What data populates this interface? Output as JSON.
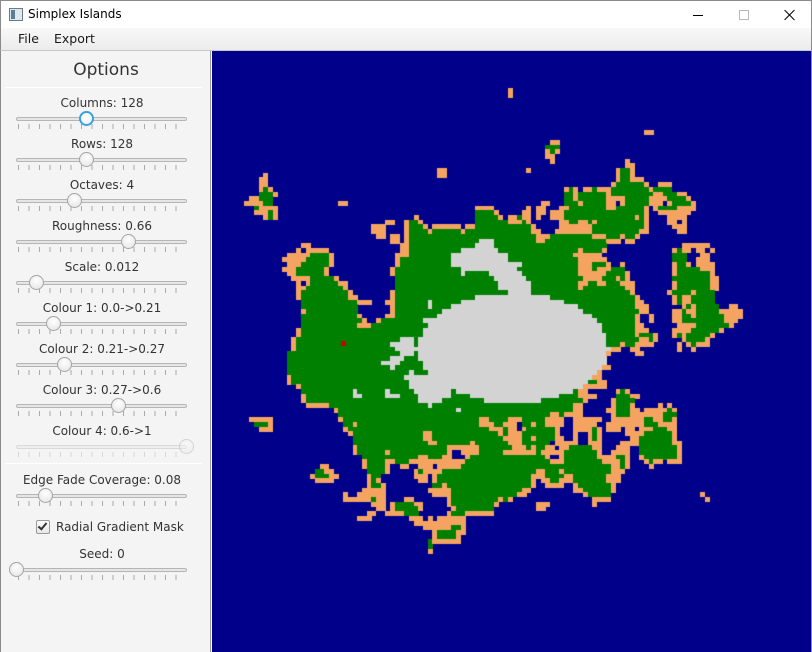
{
  "window": {
    "title": "Simplex Islands",
    "icon": "app-window-icon",
    "controls": [
      "minimize-icon",
      "maximize-icon",
      "close-icon"
    ]
  },
  "menu": {
    "file": "File",
    "export": "Export"
  },
  "options": {
    "title": "Options",
    "sliders": [
      {
        "id": "columns",
        "label": "Columns: 128",
        "fraction": 0.41,
        "focused": true,
        "disabled": false
      },
      {
        "id": "rows",
        "label": "Rows: 128",
        "fraction": 0.41,
        "focused": false,
        "disabled": false
      },
      {
        "id": "octaves",
        "label": "Octaves: 4",
        "fraction": 0.34,
        "focused": false,
        "disabled": false
      },
      {
        "id": "roughness",
        "label": "Roughness: 0.66",
        "fraction": 0.66,
        "focused": false,
        "disabled": false
      },
      {
        "id": "scale",
        "label": "Scale: 0.012",
        "fraction": 0.12,
        "focused": false,
        "disabled": false
      },
      {
        "id": "colour1",
        "label": "Colour 1: 0.0->0.21",
        "fraction": 0.22,
        "focused": false,
        "disabled": false
      },
      {
        "id": "colour2",
        "label": "Colour 2: 0.21->0.27",
        "fraction": 0.28,
        "focused": false,
        "disabled": false
      },
      {
        "id": "colour3",
        "label": "Colour 3: 0.27->0.6",
        "fraction": 0.6,
        "focused": false,
        "disabled": false
      },
      {
        "id": "colour4",
        "label": "Colour 4: 0.6->1",
        "fraction": 1.0,
        "focused": false,
        "disabled": true
      },
      {
        "id": "edge-fade",
        "label": "Edge Fade Coverage: 0.08",
        "fraction": 0.17,
        "focused": false,
        "disabled": false
      },
      {
        "id": "seed",
        "label": "Seed: 0",
        "fraction": 0.0,
        "focused": false,
        "disabled": false
      }
    ],
    "radial_mask": {
      "label": "Radial Gradient Mask",
      "checked": true
    }
  },
  "map": {
    "grid_columns": 128,
    "grid_rows": 128,
    "colors": {
      "water": "#00008b",
      "sand": "#f4a460",
      "grass": "#008000",
      "snow": "#d3d3d3",
      "marker": "#cc0000"
    }
  }
}
